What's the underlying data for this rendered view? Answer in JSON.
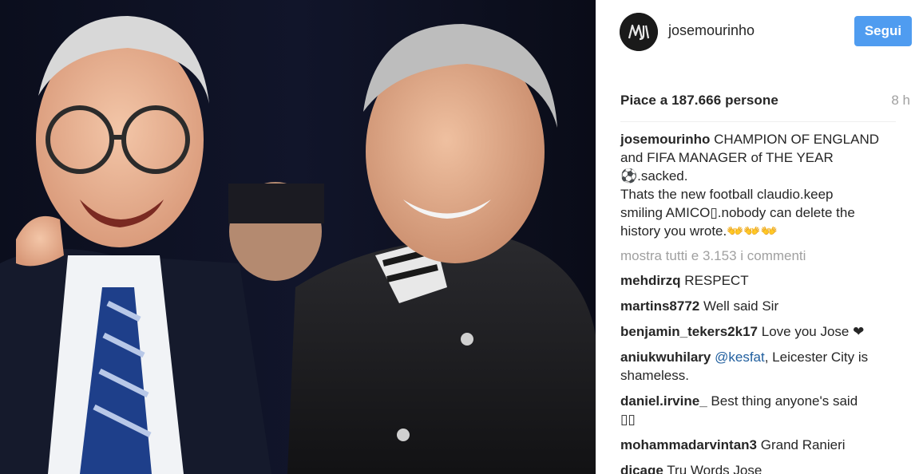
{
  "post": {
    "username": "josemourinho",
    "follow_label": "Segui",
    "likes_text": "Piace a 187.666 persone",
    "time_ago": "8 h",
    "caption": {
      "username": "josemourinho",
      "lines": [
        "CHAMPION OF ENGLAND",
        "and FIFA MANAGER of THE YEAR",
        "⚽.sacked.",
        "Thats the new football claudio.keep",
        "smiling AMICO▯.nobody can delete the",
        "history you wrote.👐👐👐"
      ]
    },
    "show_all_comments": "mostra tutti e 3.153 i commenti",
    "comments": [
      {
        "username": "mehdirzq",
        "text": "RESPECT"
      },
      {
        "username": "martins8772",
        "text": "Well said Sir"
      },
      {
        "username": "benjamin_tekers2k17",
        "text": "Love you Jose ❤"
      },
      {
        "username": "aniukwuhilary",
        "mention": "@kesfat",
        "text": ", Leicester City is",
        "text2": "shameless."
      },
      {
        "username": "daniel.irvine_",
        "text": "Best thing anyone's said",
        "text2": "▯▯"
      },
      {
        "username": "mohammadarvintan3",
        "text": "Grand Ranieri"
      },
      {
        "username": "dicage",
        "text": "Tru Words Jose"
      }
    ]
  },
  "colors": {
    "follow_button": "#4f9cf0",
    "muted_text": "#a0a0a0",
    "mention": "#1f5e9e"
  },
  "icons": {
    "avatar": "jm-monogram-logo"
  }
}
